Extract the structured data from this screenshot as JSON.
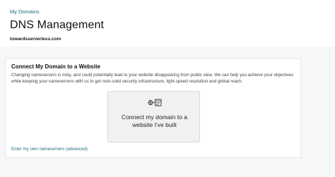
{
  "header": {
    "breadcrumb": "My Domains",
    "title": "DNS Management",
    "domain": "towardsserverless.com"
  },
  "card": {
    "title": "Connect My Domain to a Website",
    "description": "Changing nameservers is risky, and could potentially lead to your website disappearing from public view. We can help you achieve your objectives while keeping your nameservers with us to get rock-solid security infrastructure, light-speed resolution and global reach.",
    "option": {
      "icon": "website-connect-icon",
      "label_line1": "Connect my domain to a",
      "label_line2": "website I've built"
    },
    "advanced_link": "Enter my own nameservers (advanced)"
  },
  "colors": {
    "accent": "#1b6e7a",
    "page_background": "#f5f7f8",
    "tile_background": "#f0f1f2"
  }
}
